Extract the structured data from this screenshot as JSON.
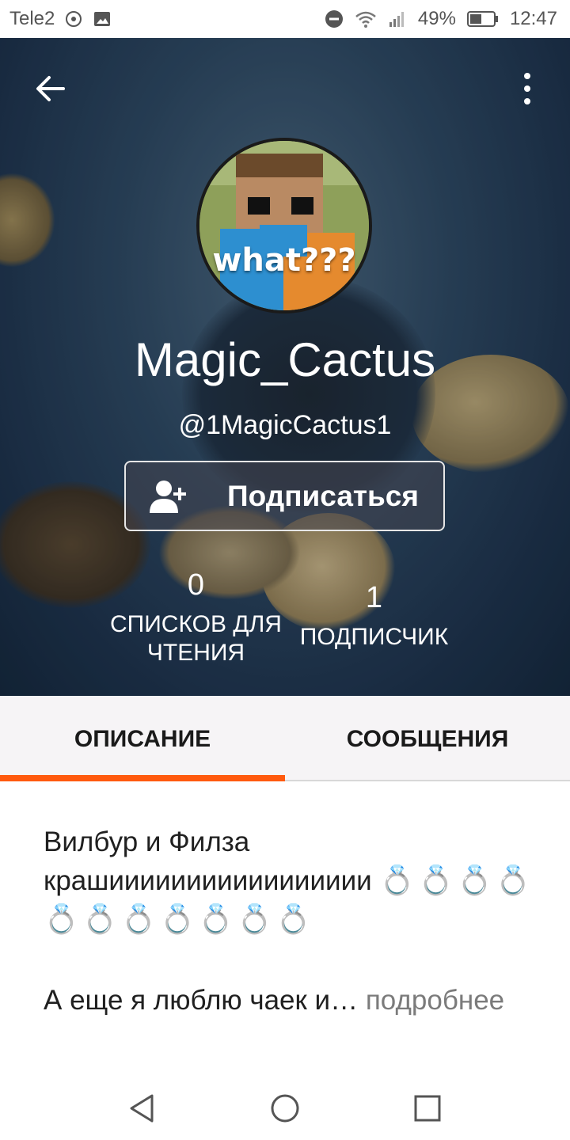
{
  "status_bar": {
    "carrier": "Tele2",
    "battery": "49%",
    "time": "12:47"
  },
  "profile": {
    "avatar_caption": "what???",
    "display_name": "Magic_Cactus",
    "username": "@1MagicCactus1",
    "follow_button": "Подписаться",
    "stats": [
      {
        "value": "0",
        "label": "СПИСКОВ ДЛЯ ЧТЕНИЯ"
      },
      {
        "value": "1",
        "label": "ПОДПИСЧИК"
      }
    ]
  },
  "tabs": [
    {
      "label": "ОПИСАНИЕ",
      "selected": true
    },
    {
      "label": "СООБЩЕНИЯ",
      "selected": false
    }
  ],
  "about": {
    "line1": "Вилбур и Филза крашиииииииииииииииии",
    "rings": "💍💍💍💍💍💍💍💍💍💍💍",
    "line2": "А еще я люблю чаек и…",
    "more_link": "подробнее"
  },
  "colors": {
    "accent": "#ff5a0e",
    "tab_background": "#f6f4f6",
    "header_background": "#2f4b66"
  },
  "icons": [
    "back-arrow-icon",
    "more-vert-icon",
    "add-user-icon",
    "nav-back-icon",
    "nav-home-icon",
    "nav-recents-icon"
  ]
}
